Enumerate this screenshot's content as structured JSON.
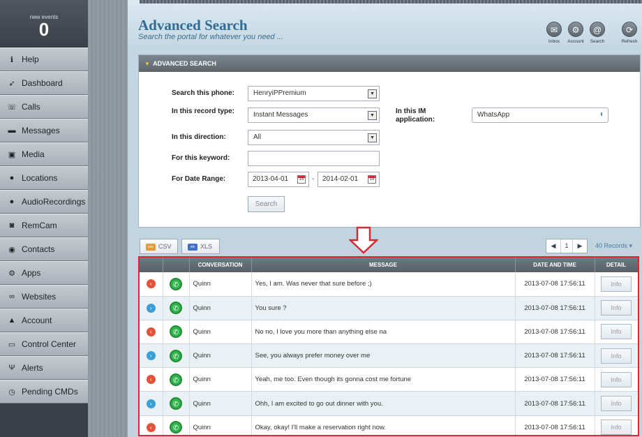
{
  "sidebar": {
    "events_label": "new events",
    "events_count": "0",
    "items": [
      {
        "label": "Help",
        "icon": "info-icon"
      },
      {
        "label": "Dashboard",
        "icon": "rocket-icon"
      },
      {
        "label": "Calls",
        "icon": "phone-icon"
      },
      {
        "label": "Messages",
        "icon": "chat-icon"
      },
      {
        "label": "Media",
        "icon": "media-icon"
      },
      {
        "label": "Locations",
        "icon": "pin-icon"
      },
      {
        "label": "AudioRecordings",
        "icon": "mic-icon"
      },
      {
        "label": "RemCam",
        "icon": "camera-icon"
      },
      {
        "label": "Contacts",
        "icon": "contacts-icon"
      },
      {
        "label": "Apps",
        "icon": "gear-icon"
      },
      {
        "label": "Websites",
        "icon": "link-icon"
      },
      {
        "label": "Account",
        "icon": "user-icon"
      },
      {
        "label": "Control Center",
        "icon": "monitor-icon"
      },
      {
        "label": "Alerts",
        "icon": "antenna-icon"
      },
      {
        "label": "Pending CMDs",
        "icon": "clock-icon"
      }
    ]
  },
  "header": {
    "title": "Advanced Search",
    "subtitle": "Search the portal for whatever you need ...",
    "toolbar": {
      "inbox": "Inbox",
      "account": "Account",
      "search": "Search",
      "refresh": "Refresh"
    }
  },
  "search_panel": {
    "heading": "ADVANCED SEARCH",
    "phone_label": "Search this phone:",
    "phone_value": "HenryiPPremium",
    "record_type_label": "In this record type:",
    "record_type_value": "Instant Messages",
    "im_app_label": "In this IM application:",
    "im_app_value": "WhatsApp",
    "direction_label": "In this direction:",
    "direction_value": "All",
    "keyword_label": "For this keyword:",
    "keyword_value": "",
    "date_label": "For Date Range:",
    "date_from": "2013-04-01",
    "date_sep": "-",
    "date_to": "2014-02-01",
    "search_button": "Search"
  },
  "export": {
    "csv": "CSV",
    "xls": "XLS"
  },
  "pager": {
    "page": "1",
    "records": "40 Records"
  },
  "table": {
    "headers": {
      "conversation": "CONVERSATION",
      "message": "MESSAGE",
      "datetime": "DATE AND TIME",
      "detail": "DETAIL"
    },
    "rows": [
      {
        "dir": "outgoing",
        "conversation": "Quinn",
        "message": "Yes, I am. Was never that sure before ;)",
        "datetime": "2013-07-08 17:56:11",
        "detail": "Info"
      },
      {
        "dir": "incoming",
        "conversation": "Quinn",
        "message": "You sure ?",
        "datetime": "2013-07-08 17:56:11",
        "detail": "Info"
      },
      {
        "dir": "outgoing",
        "conversation": "Quinn",
        "message": "No no, I love you more than anything else na",
        "datetime": "2013-07-08 17:56:11",
        "detail": "Info"
      },
      {
        "dir": "incoming",
        "conversation": "Quinn",
        "message": "See, you always prefer money over me",
        "datetime": "2013-07-08 17:56:11",
        "detail": "Info"
      },
      {
        "dir": "outgoing",
        "conversation": "Quinn",
        "message": "Yeah, me too. Even though its gonna cost me fortune",
        "datetime": "2013-07-08 17:56:11",
        "detail": "Info"
      },
      {
        "dir": "incoming",
        "conversation": "Quinn",
        "message": "Ohh, I am excited to go out dinner with you.",
        "datetime": "2013-07-08 17:56:11",
        "detail": "Info"
      },
      {
        "dir": "outgoing",
        "conversation": "Quinn",
        "message": "Okay, okay! I'll make a reservation right now.",
        "datetime": "2013-07-08 17:56:11",
        "detail": "Info"
      }
    ]
  },
  "colors": {
    "outgoing": "#e0533a",
    "incoming": "#3b9fd6",
    "highlight": "#d42a32"
  }
}
